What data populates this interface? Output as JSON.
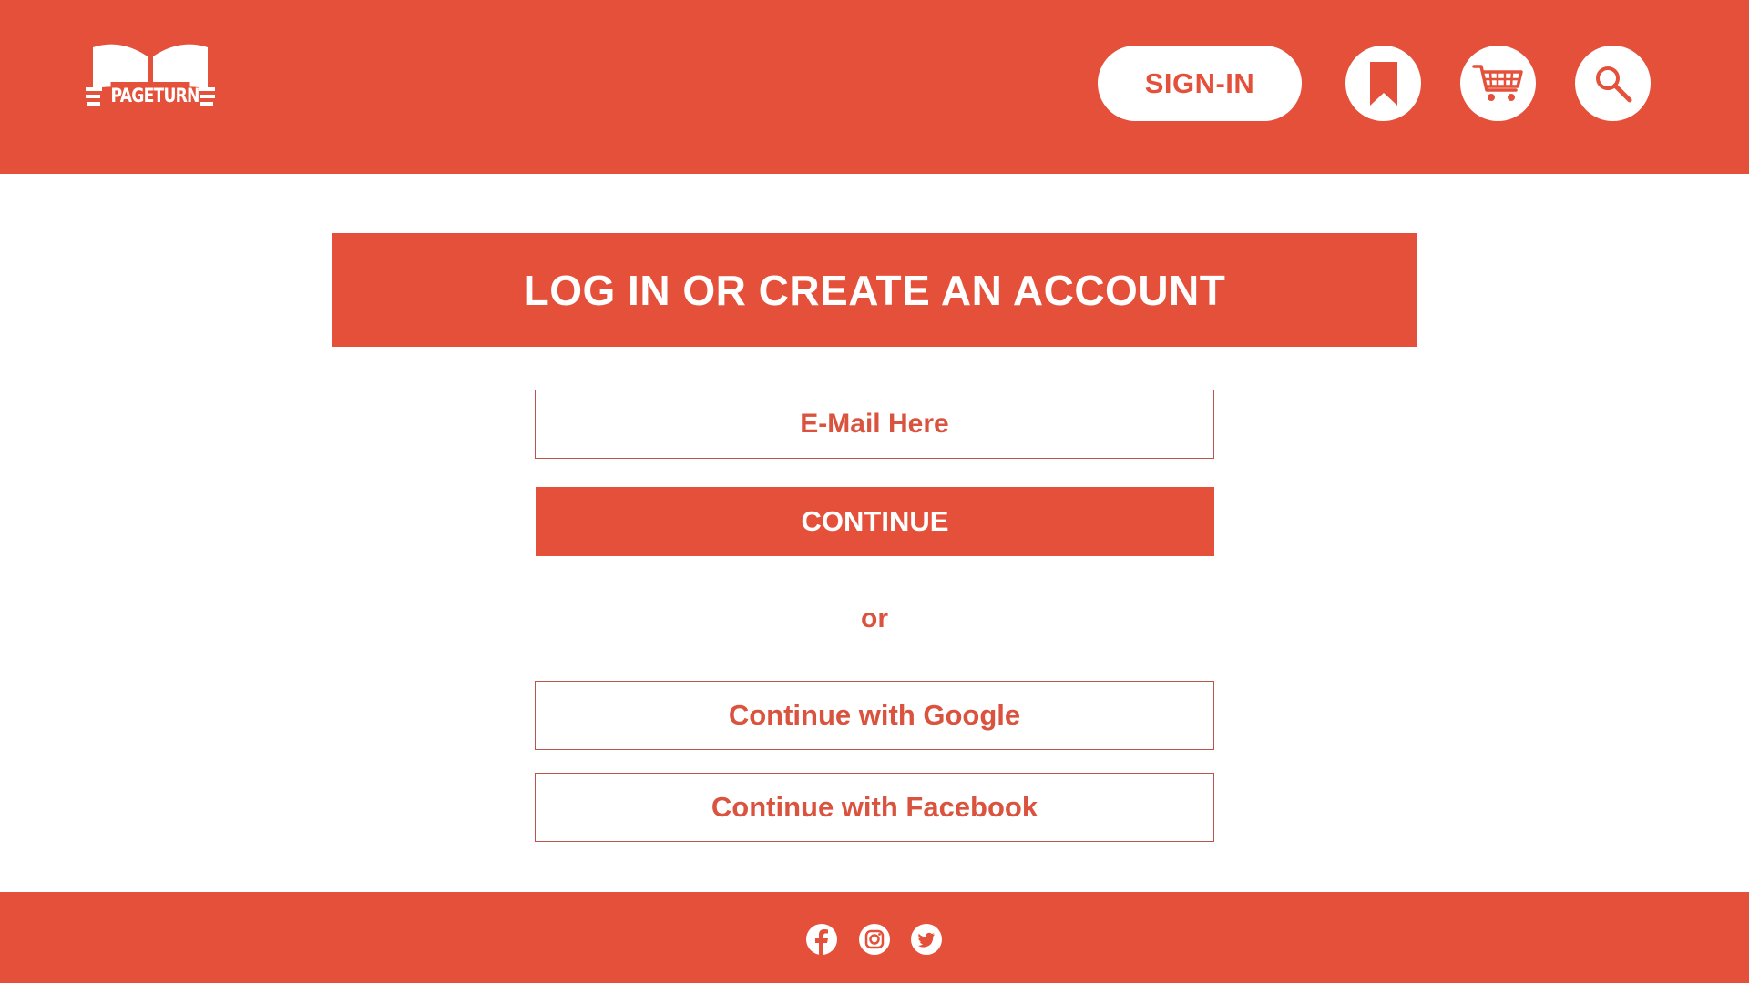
{
  "brand": {
    "logo_text": "PAGETURN",
    "accent_color": "#e5503a",
    "background_color": "#ffffff"
  },
  "header": {
    "signin_label": "SIGN-IN",
    "icons": [
      "bookmark-icon",
      "cart-icon",
      "search-icon"
    ]
  },
  "main": {
    "title": "LOG IN OR CREATE AN ACCOUNT",
    "email_placeholder": "E-Mail Here",
    "continue_label": "CONTINUE",
    "or_text": "or",
    "google_label": "Continue with Google",
    "facebook_label": "Continue with Facebook"
  },
  "footer": {
    "social_icons": [
      "facebook-icon",
      "instagram-icon",
      "twitter-icon"
    ]
  }
}
